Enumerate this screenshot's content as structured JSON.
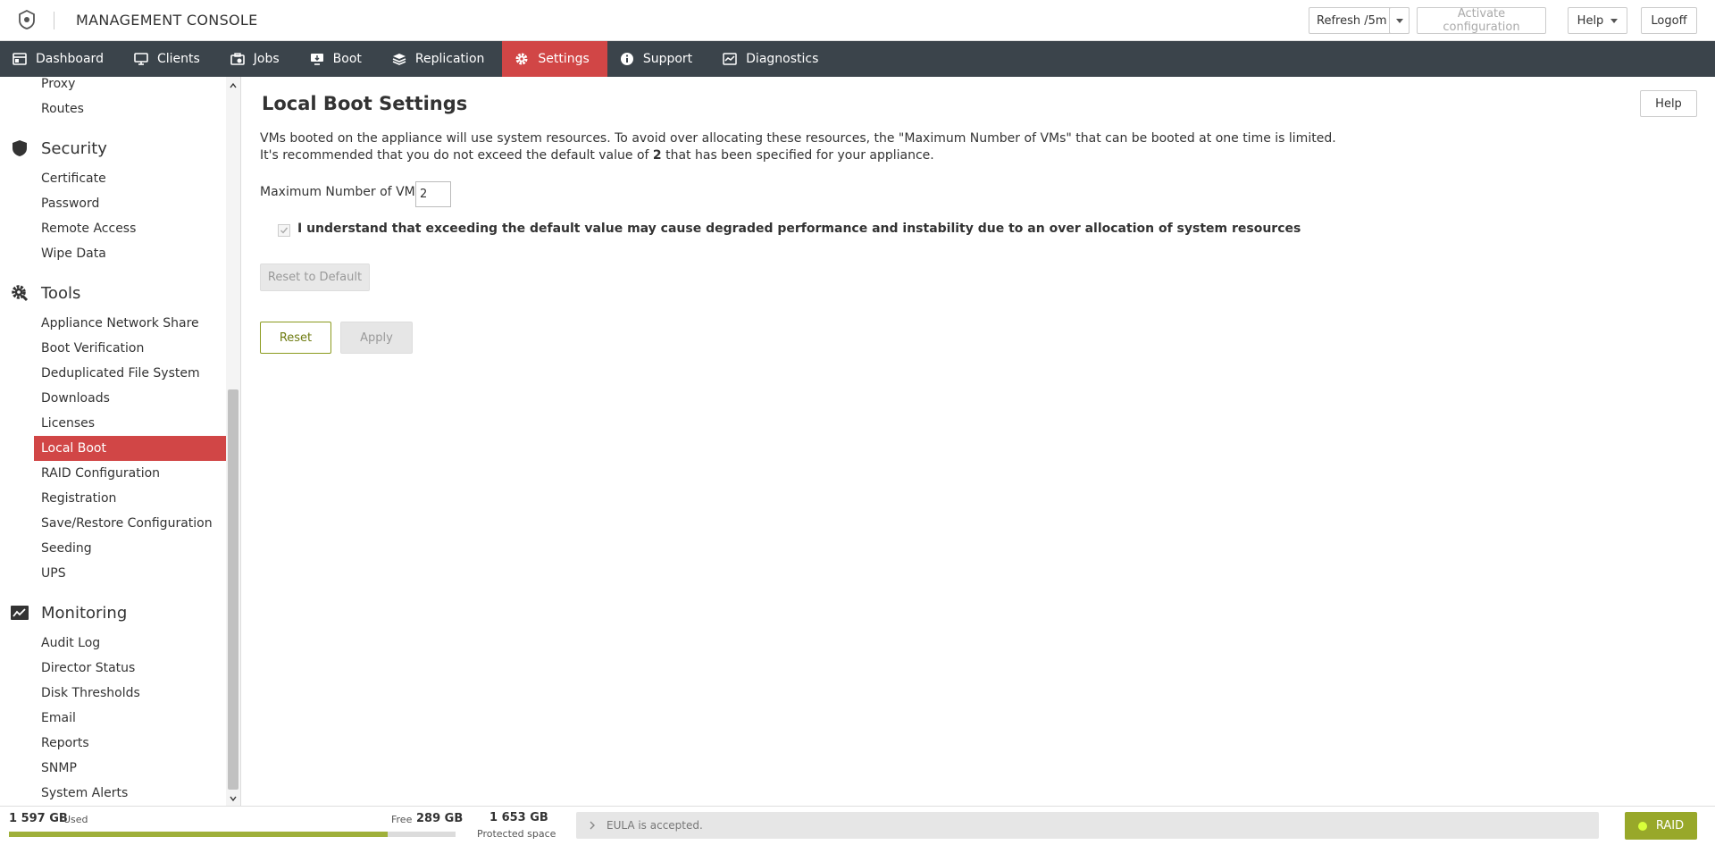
{
  "header": {
    "title": "MANAGEMENT CONSOLE",
    "refresh_label": "Refresh /5m",
    "activate_label": "Activate configuration",
    "help_label": "Help",
    "logoff_label": "Logoff"
  },
  "nav": {
    "items": [
      {
        "label": "Dashboard",
        "icon": "dashboard-icon"
      },
      {
        "label": "Clients",
        "icon": "monitor-icon"
      },
      {
        "label": "Jobs",
        "icon": "jobs-icon"
      },
      {
        "label": "Boot",
        "icon": "boot-icon"
      },
      {
        "label": "Replication",
        "icon": "replication-icon"
      },
      {
        "label": "Settings",
        "icon": "gear-icon",
        "active": true
      },
      {
        "label": "Support",
        "icon": "info-icon"
      },
      {
        "label": "Diagnostics",
        "icon": "diagnostics-icon"
      }
    ]
  },
  "sidebar": {
    "top_items": [
      "Proxy",
      "Routes"
    ],
    "security": {
      "title": "Security",
      "items": [
        "Certificate",
        "Password",
        "Remote Access",
        "Wipe Data"
      ]
    },
    "tools": {
      "title": "Tools",
      "items": [
        "Appliance Network Share",
        "Boot Verification",
        "Deduplicated File System",
        "Downloads",
        "Licenses",
        "Local Boot",
        "RAID Configuration",
        "Registration",
        "Save/Restore Configuration",
        "Seeding",
        "UPS"
      ],
      "active": "Local Boot"
    },
    "monitoring": {
      "title": "Monitoring",
      "items": [
        "Audit Log",
        "Director Status",
        "Disk Thresholds",
        "Email",
        "Reports",
        "SNMP",
        "System Alerts"
      ]
    }
  },
  "main": {
    "title": "Local Boot Settings",
    "help_label": "Help",
    "desc_line1": "VMs booted on the appliance will use system resources. To avoid over allocating these resources, the \"Maximum Number of VMs\" that can be booted at one time is limited.",
    "desc_line2_pre": "It's recommended that you do not exceed the default value of ",
    "desc_line2_value": "2",
    "desc_line2_post": " that has been specified for your appliance.",
    "max_vms_label": "Maximum Number of VMs:",
    "max_vms_value": "2",
    "checkbox_label": "I understand that exceeding the default value may cause degraded performance and instability due to an over allocation of system resources",
    "checkbox_checked": true,
    "reset_default_label": "Reset to Default",
    "reset_label": "Reset",
    "apply_label": "Apply"
  },
  "footer": {
    "used_value": "1 597 GB",
    "used_label": "Used",
    "free_label": "Free",
    "free_value": "289 GB",
    "used_fraction": 0.847,
    "protected_value": "1 653 GB",
    "protected_label": "Protected space",
    "eula_text": "EULA is accepted.",
    "raid_label": "RAID"
  },
  "colors": {
    "nav_bg": "#3b444b",
    "accent_red": "#d14646",
    "accent_green": "#98a82a"
  }
}
